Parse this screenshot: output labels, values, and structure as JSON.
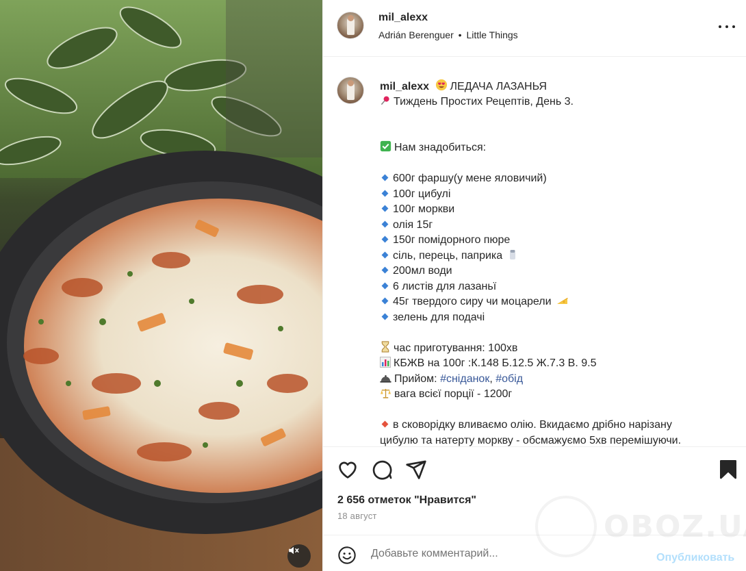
{
  "post": {
    "username": "mil_alexx",
    "audio_artist": "Adrián Berenguer",
    "audio_separator": "•",
    "audio_track": "Little Things"
  },
  "caption": {
    "username": "mil_alexx",
    "title": "ЛЕДАЧА ЛАЗАНЬЯ",
    "subtitle": "Тиждень Простих Рецептів, День 3.",
    "need_title": "Нам знадобиться:",
    "ingredients": [
      "600г фаршу(у мене яловичий)",
      "100г цибулі",
      "100г моркви",
      "олія 15г",
      "150г помідорного пюре",
      "сіль, перець, паприка",
      "200мл води",
      "6 листів для лазаньї",
      "45г твердого сиру чи моцарели",
      "зелень для подачі"
    ],
    "cook_time": "час приготування: 100хв",
    "kbzhv": "КБЖВ на 100г :К.148 Б.12.5 Ж.7.3 В. 9.5",
    "meal_label": "Прийом: ",
    "meal_tag1": "#сніданок",
    "meal_sep": ", ",
    "meal_tag2": "#обід",
    "weight": "вага всієї порції - 1200г",
    "step1_line1": "в сковорідку вливаємо олію. Вкидаємо дрібно нарізану",
    "step1_line2": "цибулю та натерту моркву - обсмажуємо 5хв перемішуючи."
  },
  "stats": {
    "likes": "2 656 отметок \"Нравится\"",
    "date": "18 август"
  },
  "comment": {
    "placeholder": "Добавьте комментарий...",
    "post_label": "Опубликовать"
  },
  "watermark": {
    "text": "OBOZ.UA"
  },
  "colors": {
    "hashtag": "#385898",
    "post_button": "#b2dffc",
    "text": "#262626",
    "muted": "#8e8e8e"
  },
  "icons": [
    "more-icon",
    "heart-icon",
    "comment-icon",
    "share-icon",
    "bookmark-icon",
    "emoji-icon",
    "mute-icon"
  ]
}
